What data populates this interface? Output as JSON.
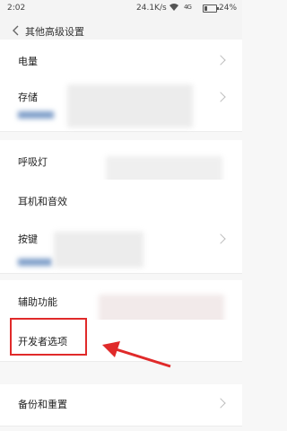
{
  "status_bar": {
    "time": "2:02",
    "speed": "24.1K/s",
    "signal_label": "4G",
    "battery_percent": "24%",
    "battery_level": 0.24
  },
  "header": {
    "back_icon": "back-chevron-icon",
    "title": "其他高级设置"
  },
  "settings": {
    "items": [
      {
        "label": "电量"
      },
      {
        "label": "存储"
      },
      {
        "label": "呼吸灯"
      },
      {
        "label": "耳机和音效"
      },
      {
        "label": "按键"
      },
      {
        "label": "辅助功能"
      },
      {
        "label": "开发者选项"
      },
      {
        "label": "备份和重置"
      }
    ]
  },
  "annotation": {
    "highlight_color": "#e02a2a",
    "arrow_color": "#e02a2a"
  }
}
